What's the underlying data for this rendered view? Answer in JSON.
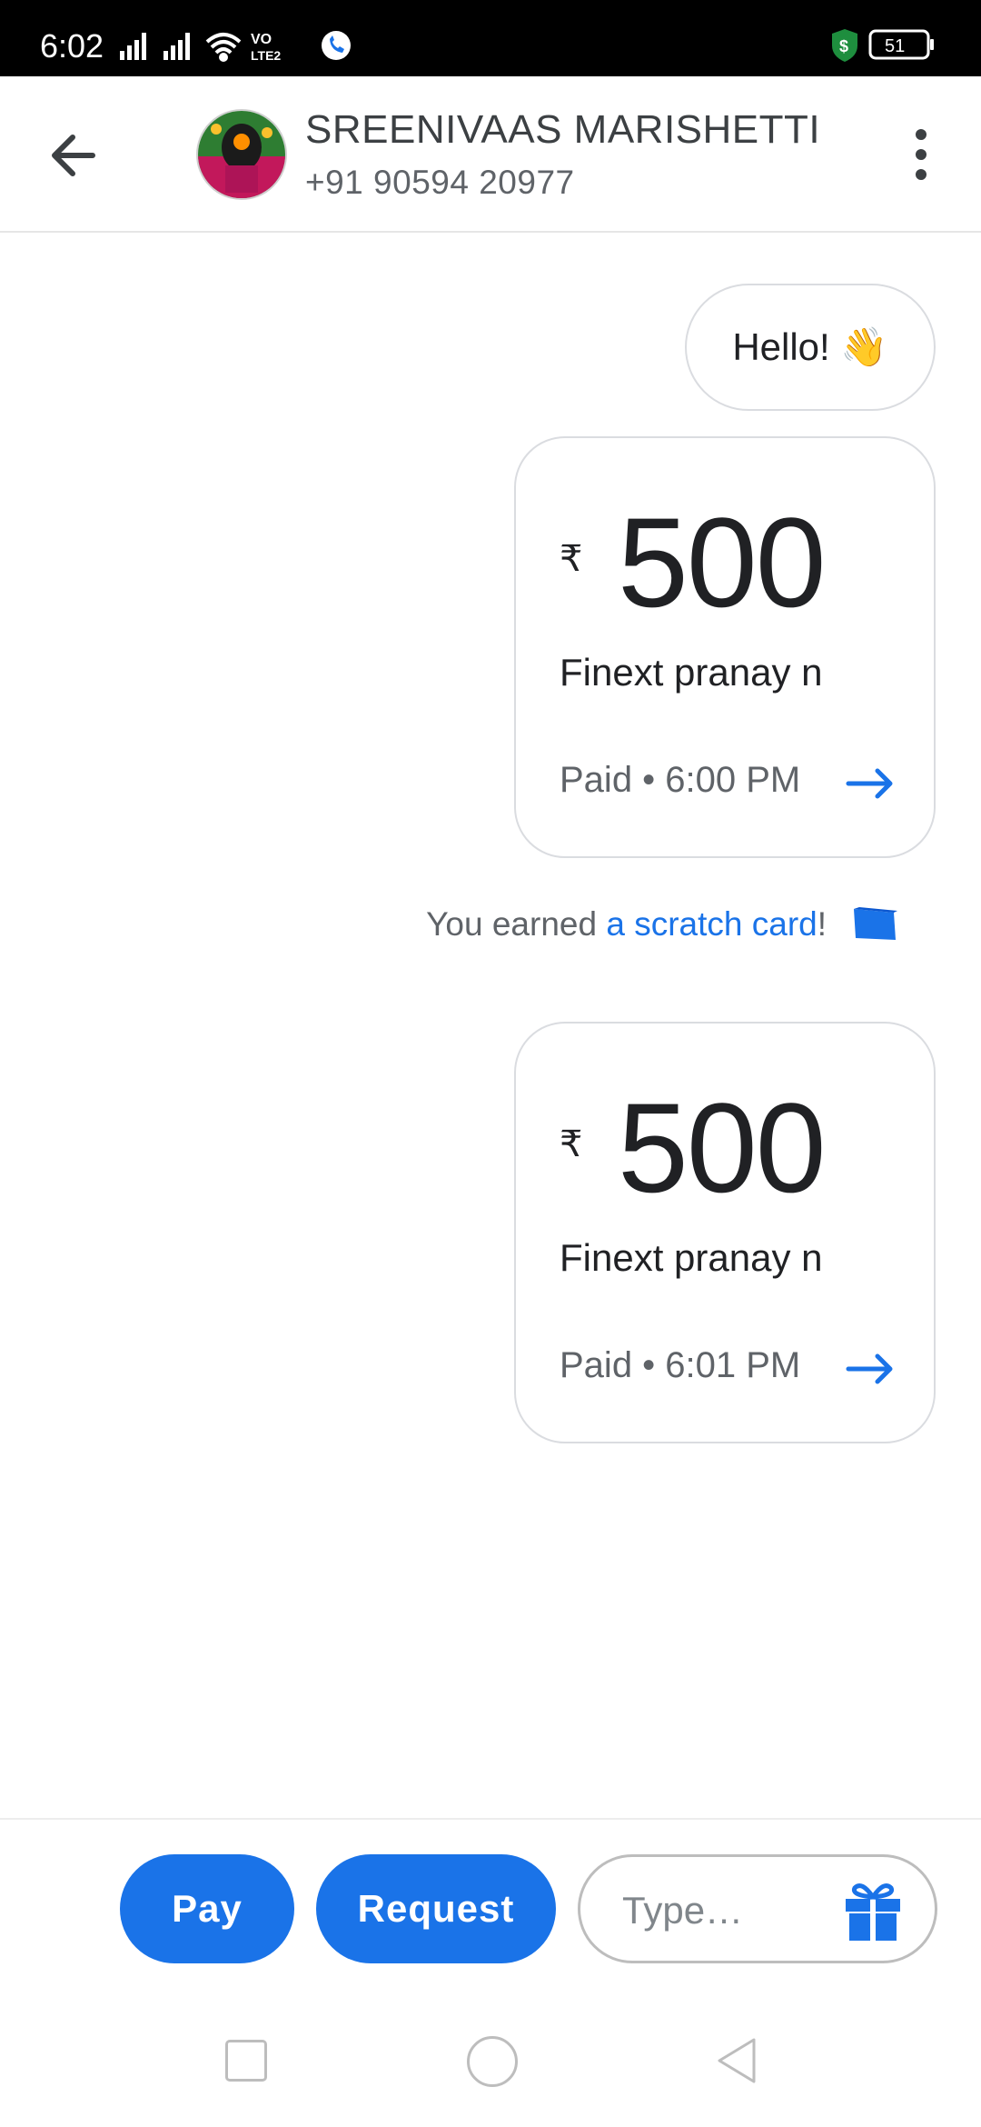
{
  "status_bar": {
    "time": "6:02",
    "battery": "51",
    "icons": [
      "signal-icon",
      "signal-icon",
      "wifi-icon",
      "volte-icon",
      "call-icon",
      "shield-dollar-icon",
      "battery-icon"
    ],
    "volte_label": "VO LTE2"
  },
  "header": {
    "name": "SREENIVAAS MARISHETTI",
    "phone": "+91 90594 20977",
    "back_icon": "arrow-back-icon",
    "menu_icon": "more-vert-icon"
  },
  "messages": {
    "hello": "Hello! 👋",
    "payments": [
      {
        "currency": "₹",
        "amount": "500",
        "note": "Finext pranay n",
        "status": "Paid • 6:00 PM"
      },
      {
        "currency": "₹",
        "amount": "500",
        "note": "Finext pranay n",
        "status": "Paid • 6:01 PM"
      }
    ],
    "scratch": {
      "prefix": "You earned ",
      "link": "a scratch card",
      "suffix": "!"
    }
  },
  "bottom_bar": {
    "pay_label": "Pay",
    "request_label": "Request",
    "type_placeholder": "Type…",
    "gift_icon": "gift-icon"
  },
  "colors": {
    "accent": "#1a73e8",
    "text_primary": "#202124",
    "text_secondary": "#5f6368",
    "border": "#dadce0"
  }
}
